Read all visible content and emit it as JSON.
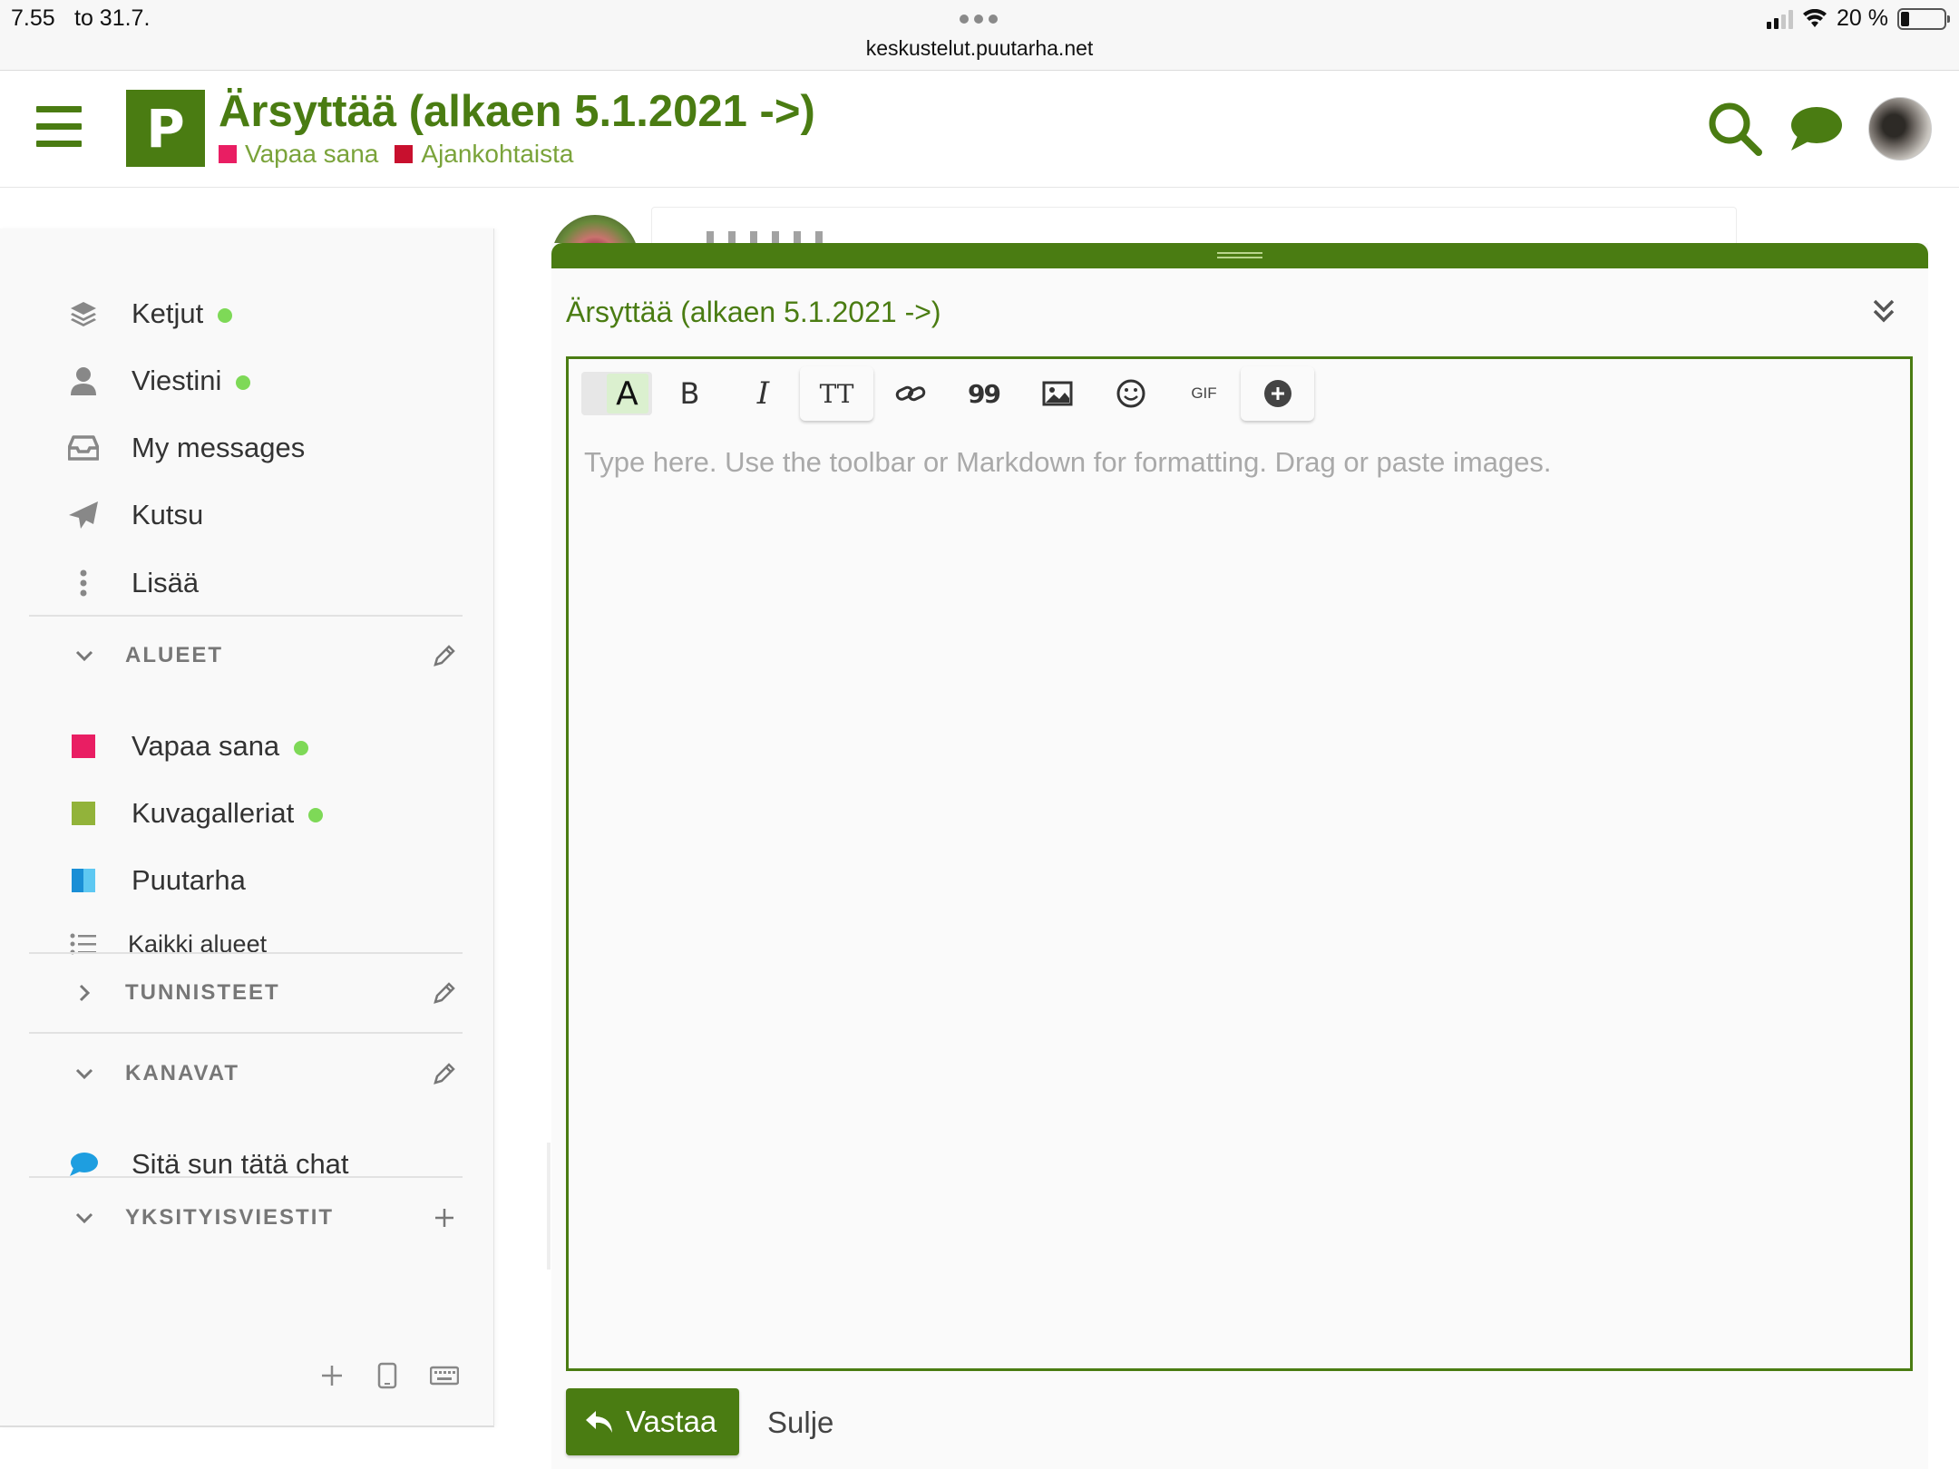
{
  "status_bar": {
    "time": "7.55",
    "date": "to 31.7.",
    "url": "keskustelut.puutarha.net",
    "battery": "20 %"
  },
  "header": {
    "logo_letter": "P",
    "title": "Ärsyttää (alkaen 5.1.2021 ->)",
    "categories": [
      {
        "label": "Vapaa sana",
        "color": "#e91e63"
      },
      {
        "label": "Ajankohtaista",
        "color": "#c8102e"
      }
    ]
  },
  "sidebar": {
    "nav": [
      {
        "label": "Ketjut",
        "icon": "layers-icon",
        "dot": true
      },
      {
        "label": "Viestini",
        "icon": "user-icon",
        "dot": true
      },
      {
        "label": "My messages",
        "icon": "inbox-icon",
        "dot": false
      },
      {
        "label": "Kutsu",
        "icon": "paper-plane-icon",
        "dot": false
      },
      {
        "label": "Lisää",
        "icon": "vertical-ellipsis-icon",
        "dot": false
      }
    ],
    "sections": {
      "alueet": "ALUEET",
      "tunnisteet": "TUNNISTEET",
      "kanavat": "KANAVAT",
      "yksityisviestit": "YKSITYISVIESTIT"
    },
    "categories": [
      {
        "label": "Vapaa sana",
        "color": "#e91e63",
        "dot": true
      },
      {
        "label": "Kuvagalleriat",
        "color": "#92b33a",
        "dot": true
      },
      {
        "label": "Puutarha",
        "color": "#1a8fd6",
        "dot": false
      }
    ],
    "all_categories": "Kaikki alueet",
    "channel": "Sitä sun tätä chat"
  },
  "composer": {
    "reply_title": "Ärsyttää (alkaen 5.1.2021 ->)",
    "toolbar": {
      "format_letter": "A",
      "bold": "B",
      "italic": "I",
      "heading": "TT",
      "quote": "99",
      "gif": "GIF"
    },
    "placeholder": "Type here. Use the toolbar or Markdown for formatting. Drag or paste images.",
    "reply_label": "Vastaa",
    "close_label": "Sulje"
  },
  "colors": {
    "brand": "#4a7c12",
    "online_dot": "#7ed957"
  }
}
